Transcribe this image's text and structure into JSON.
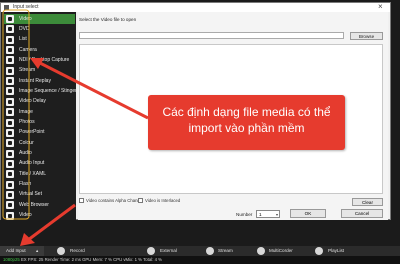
{
  "dialog": {
    "title": "Input select",
    "prompt": "Select the Video file to open",
    "browse_label": "Browse",
    "checkbox_alpha": "Video contains Alpha Channel",
    "checkbox_interlaced": "Video is Interlaced",
    "clear_label": "Clear",
    "number_label": "Number",
    "number_value": "1",
    "ok_label": "OK",
    "cancel_label": "Cancel"
  },
  "input_types": [
    {
      "label": "Video",
      "selected": true
    },
    {
      "label": "DVD"
    },
    {
      "label": "List"
    },
    {
      "label": "Camera"
    },
    {
      "label": "NDI / Desktop Capture"
    },
    {
      "label": "Stream"
    },
    {
      "label": "Instant Replay"
    },
    {
      "label": "Image Sequence / Stinger"
    },
    {
      "label": "Video Delay"
    },
    {
      "label": "Image"
    },
    {
      "label": "Photos"
    },
    {
      "label": "PowerPoint"
    },
    {
      "label": "Colour"
    },
    {
      "label": "Audio"
    },
    {
      "label": "Audio Input"
    },
    {
      "label": "Title / XAML"
    },
    {
      "label": "Flash"
    },
    {
      "label": "Virtual Set"
    },
    {
      "label": "Web Browser"
    },
    {
      "label": "Video"
    }
  ],
  "bottom_bar": {
    "add_input": "Add Input",
    "record": "Record",
    "external": "External",
    "stream": "Stream",
    "multicorder": "MultiCorder",
    "playlist": "PlayList"
  },
  "status": {
    "res": "1080p25",
    "rest": "EX  FPS: 25  Render Time: 2 ms  GPU Mem: 7 %  CPU vMix: 1 %  Total: 4 %"
  },
  "annotation": {
    "text": "Các định dạng file media có thể import vào phần mềm",
    "color": "#e63b2e"
  }
}
